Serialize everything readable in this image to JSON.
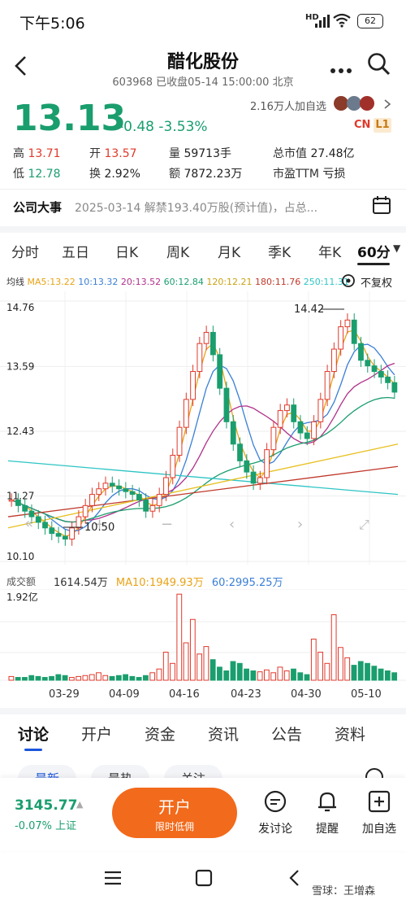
{
  "status_bar": {
    "time": "下午5:06",
    "signal_label": "HD",
    "battery": "62"
  },
  "header": {
    "title": "醋化股份",
    "subtitle": "603968 已收盘05-14 15:00:00 北京"
  },
  "quote": {
    "price": "13.13",
    "change": "-0.48",
    "change_pct": "-3.53%",
    "followers": "2.16万人加自选",
    "badge_cn": "CN",
    "badge_l1": "L1",
    "high_label": "高",
    "high": "13.71",
    "open_label": "开",
    "open": "13.57",
    "volume_label": "量",
    "volume": "59713手",
    "mktcap_label": "总市值",
    "mktcap": "27.48亿",
    "low_label": "低",
    "low": "12.78",
    "turnover_label": "换",
    "turnover": "2.92%",
    "amount_label": "额",
    "amount": "7872.23万",
    "pe_label": "市盈TTM",
    "pe": "亏损"
  },
  "event": {
    "label": "公司大事",
    "text": "2025-03-14 解禁193.40万股(预计值)，占总..."
  },
  "period_tabs": [
    "分时",
    "五日",
    "日K",
    "周K",
    "月K",
    "季K",
    "年K",
    "60分"
  ],
  "ma_legend": {
    "avg": "均线",
    "ma5": "MA5:13.22",
    "ma10": "10:13.32",
    "ma20": "20:13.52",
    "ma60": "60:12.84",
    "ma120": "120:12.21",
    "ma180": "180:11.76",
    "ma250": "250:11.31",
    "adjust": "不复权"
  },
  "chart_data": {
    "type": "candlestick",
    "y_ticks": [
      "14.76",
      "13.59",
      "12.43",
      "11.27",
      "10.10"
    ],
    "ylim": [
      10.1,
      14.76
    ],
    "high_marker": "14.42",
    "low_marker": "10.50",
    "x_ticks": [
      "03-29",
      "04-09",
      "04-16",
      "04-23",
      "04-30",
      "05-10"
    ],
    "volume_label": "成交额",
    "volume_value": "1614.54万",
    "volume_ma10": "MA10:1949.93万",
    "volume_ma60": "60:2995.25万",
    "volume_ymax": "1.92亿",
    "colors": {
      "up": "#e0392b",
      "down": "#1a9e6e",
      "ma5": "#e8a317",
      "ma10": "#3a7fd6",
      "ma20": "#b0308a",
      "ma60": "#1a9e6e",
      "ma120": "#e8c020",
      "ma180": "#c0392b",
      "ma250": "#2ec4c4"
    }
  },
  "bottom_tabs": [
    "讨论",
    "开户",
    "资金",
    "资讯",
    "公告",
    "资料"
  ],
  "filter_pills": [
    "最新",
    "最热",
    "关注"
  ],
  "index_bar": {
    "value": "3145.77",
    "change": "-0.07% 上证"
  },
  "open_account": {
    "label": "开户",
    "sub": "限时低佣"
  },
  "actions": [
    {
      "label": "发讨论",
      "icon": "comment-icon"
    },
    {
      "label": "提醒",
      "icon": "bell-icon"
    },
    {
      "label": "加自选",
      "icon": "add-watchlist-icon"
    }
  ],
  "watermark": "雪球：王增森"
}
